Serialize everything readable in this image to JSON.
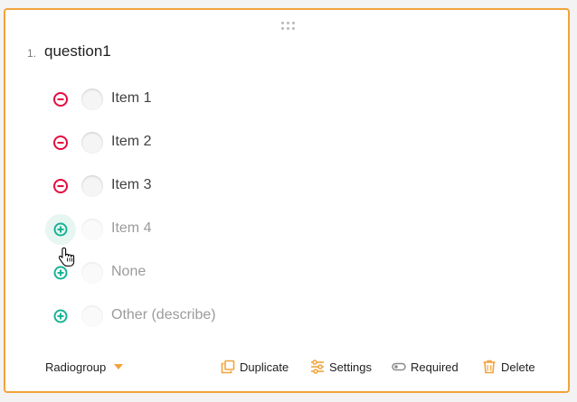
{
  "question": {
    "number": "1.",
    "title": "question1"
  },
  "choices": [
    {
      "label": "Item 1",
      "action": "remove",
      "action_icon": "minus-circle-icon"
    },
    {
      "label": "Item 2",
      "action": "remove",
      "action_icon": "minus-circle-icon"
    },
    {
      "label": "Item 3",
      "action": "remove",
      "action_icon": "minus-circle-icon"
    },
    {
      "label": "Item 4",
      "action": "add",
      "action_icon": "plus-circle-icon"
    },
    {
      "label": "None",
      "action": "add",
      "action_icon": "plus-circle-icon"
    },
    {
      "label": "Other (describe)",
      "action": "add",
      "action_icon": "plus-circle-icon"
    }
  ],
  "footer": {
    "type_label": "Radiogroup",
    "duplicate_label": "Duplicate",
    "settings_label": "Settings",
    "required_label": "Required",
    "delete_label": "Delete"
  },
  "colors": {
    "accent": "#f2a33a",
    "remove": "#e50a3e",
    "add": "#19b394"
  }
}
